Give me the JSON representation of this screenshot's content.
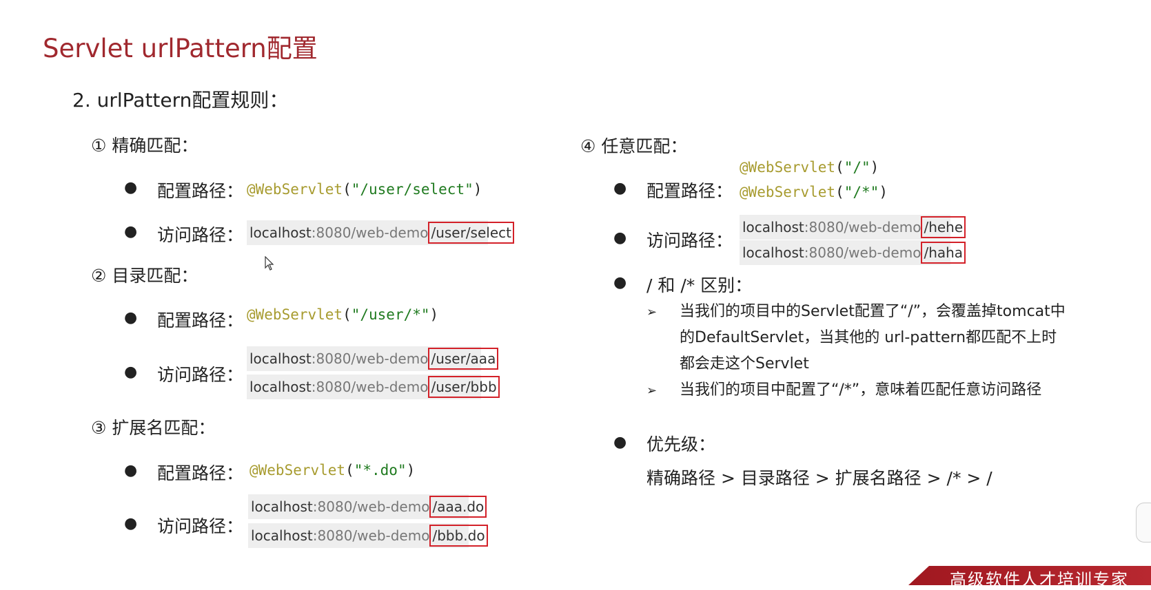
{
  "title": "Servlet urlPattern配置",
  "subtitle": "2. urlPattern配置规则：",
  "sections": {
    "exact": {
      "heading": "① 精确匹配：",
      "config_label": "配置路径：",
      "config_code": {
        "anno": "@WebServlet",
        "open": "(",
        "str": "\"/user/select\"",
        "close": ")"
      },
      "access_label": "访问路径：",
      "urls": [
        {
          "host": "localhost",
          "port": ":8080",
          "path": "/web-demo",
          "hl": "/user/select"
        }
      ]
    },
    "dir": {
      "heading": "② 目录匹配：",
      "config_label": "配置路径：",
      "config_code": {
        "anno": "@WebServlet",
        "open": "(",
        "str": "\"/user/*\"",
        "close": ")"
      },
      "access_label": "访问路径：",
      "urls": [
        {
          "host": "localhost",
          "port": ":8080",
          "path": "/web-demo",
          "hl": "/user/aaa"
        },
        {
          "host": "localhost",
          "port": ":8080",
          "path": "/web-demo",
          "hl": "/user/bbb"
        }
      ]
    },
    "ext": {
      "heading": "③ 扩展名匹配：",
      "config_label": "配置路径：",
      "config_code": {
        "anno": "@WebServlet",
        "open": "(",
        "str": "\"*.do\"",
        "close": ")"
      },
      "access_label": "访问路径：",
      "urls": [
        {
          "host": "localhost",
          "port": ":8080",
          "path": "/web-demo",
          "hl": "/aaa.do"
        },
        {
          "host": "localhost",
          "port": ":8080",
          "path": "/web-demo",
          "hl": "/bbb.do"
        }
      ]
    },
    "any": {
      "heading": "④ 任意匹配：",
      "config_label": "配置路径：",
      "config_codes": [
        {
          "anno": "@WebServlet",
          "open": "(",
          "str": "\"/\"",
          "close": ")"
        },
        {
          "anno": "@WebServlet",
          "open": "(",
          "str": "\"/*\"",
          "close": ")"
        }
      ],
      "access_label": "访问路径：",
      "urls": [
        {
          "host": "localhost",
          "port": ":8080",
          "path": "/web-demo",
          "hl": "/hehe"
        },
        {
          "host": "localhost",
          "port": ":8080",
          "path": "/web-demo",
          "hl": "/haha"
        }
      ]
    }
  },
  "diff": {
    "heading": "/ 和 /* 区别：",
    "notes": [
      "当我们的项目中的Servlet配置了“/”，会覆盖掉tomcat中的DefaultServlet，当其他的 url-pattern都匹配不上时都会走这个Servlet",
      "当我们的项目中配置了“/*”，意味着匹配任意访问路径"
    ]
  },
  "priority": {
    "heading": "优先级：",
    "order": "精确路径 > 目录路径 > 扩展名路径 > /* > /"
  },
  "footer": "高级软件人才培训专家",
  "colors": {
    "title": "#a0282e",
    "highlight_border": "#d32028",
    "annotation": "#a79b2f",
    "string": "#1f7a1f",
    "footer_bg": "#a01820"
  }
}
